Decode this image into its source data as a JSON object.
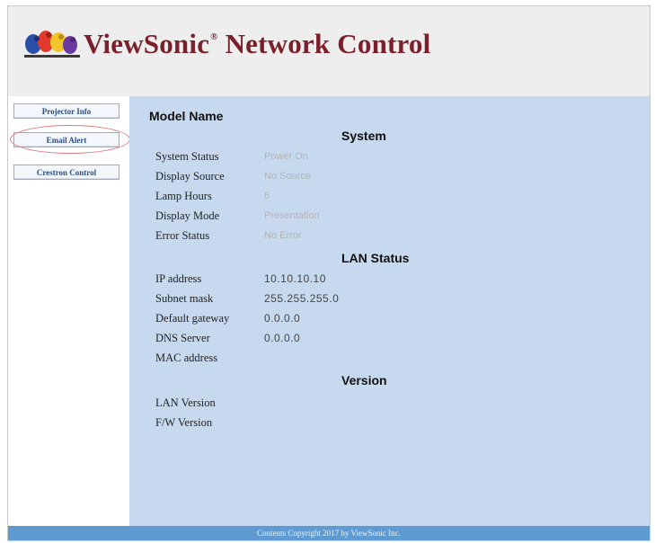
{
  "header": {
    "brand_name": "ViewSonic",
    "brand_reg": "®",
    "brand_rest": "Network Control",
    "logo_icon": "birds-logo-icon"
  },
  "sidebar": {
    "items": [
      {
        "label": "Projector Info"
      },
      {
        "label": "Email Alert"
      },
      {
        "label": "Crestron Control"
      }
    ]
  },
  "main": {
    "model_name_label": "Model Name",
    "system": {
      "title": "System",
      "rows": [
        {
          "label": "System Status",
          "value": "Power On"
        },
        {
          "label": "Display Source",
          "value": "No Source"
        },
        {
          "label": "Lamp Hours",
          "value": "6"
        },
        {
          "label": "Display Mode",
          "value": "Presentation"
        },
        {
          "label": "Error Status",
          "value": "No Error"
        }
      ]
    },
    "lan": {
      "title": "LAN Status",
      "rows": [
        {
          "label": "IP address",
          "value": "10.10.10.10"
        },
        {
          "label": "Subnet mask",
          "value": "255.255.255.0"
        },
        {
          "label": "Default gateway",
          "value": "0.0.0.0"
        },
        {
          "label": "DNS Server",
          "value": "0.0.0.0"
        },
        {
          "label": "MAC address",
          "value": ""
        }
      ]
    },
    "version": {
      "title": "Version",
      "rows": [
        {
          "label": "LAN Version",
          "value": ""
        },
        {
          "label": "F/W Version",
          "value": ""
        }
      ]
    }
  },
  "footer": {
    "copyright": "Contents Copyright 2017 by ViewSonic Inc."
  },
  "colors": {
    "brand": "#7a1f2b",
    "content_bg": "#c6d9ef",
    "footer_bg": "#5f9bd0",
    "highlight_ring": "#e07b7b"
  }
}
